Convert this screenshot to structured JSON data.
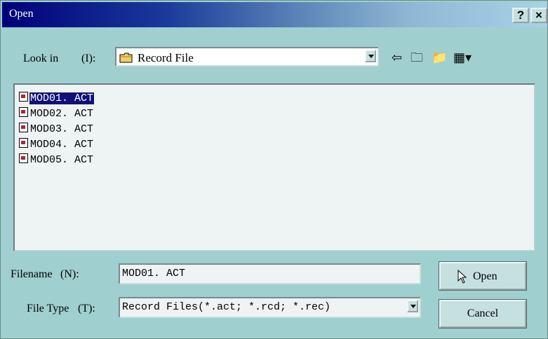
{
  "window": {
    "title": "Open",
    "help_label": "?",
    "close_label": "×"
  },
  "look_in": {
    "label": "Look in",
    "mnemonic": "(I):",
    "value": "Record File",
    "folder_icon": "folder-icon"
  },
  "toolbar": {
    "back_icon": "⇦",
    "up_icon": "🗀",
    "new_folder_icon": "📁",
    "view_icon": "▦▾"
  },
  "files": [
    {
      "name": "MOD01. ACT",
      "selected": true
    },
    {
      "name": "MOD02. ACT",
      "selected": false
    },
    {
      "name": "MOD03. ACT",
      "selected": false
    },
    {
      "name": "MOD04. ACT",
      "selected": false
    },
    {
      "name": "MOD05. ACT",
      "selected": false
    }
  ],
  "filename": {
    "label": "Filename",
    "mnemonic": "(N):",
    "value": "MOD01. ACT"
  },
  "filetype": {
    "label": "File Type",
    "mnemonic": "(T):",
    "value": "Record Files(*.act; *.rcd; *.rec)"
  },
  "buttons": {
    "open": "Open",
    "cancel": "Cancel"
  }
}
